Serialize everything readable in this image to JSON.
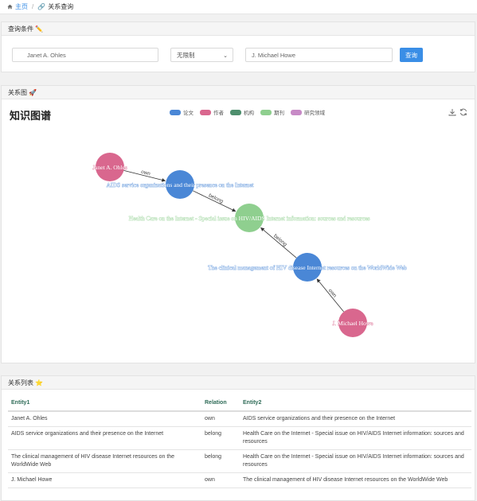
{
  "breadcrumb": {
    "home": "主页",
    "current": "关系查询"
  },
  "query": {
    "header": "查询条件",
    "header_emoji": "✏️",
    "entity1_value": "Janet A. Ohles",
    "relation_value": "无限制",
    "entity2_value": "J. Michael Howe",
    "search_label": "查询"
  },
  "graph": {
    "header": "关系图",
    "header_emoji": "🚀",
    "title": "知识图谱",
    "legend": [
      {
        "label": "论文",
        "color": "#4a87d6"
      },
      {
        "label": "作者",
        "color": "#d9678e"
      },
      {
        "label": "机构",
        "color": "#4e8f6e"
      },
      {
        "label": "期刊",
        "color": "#8fcf8f"
      },
      {
        "label": "研究领域",
        "color": "#c78ac6"
      }
    ],
    "nodes": [
      {
        "label": "Janet A. Ohles",
        "type": "作者",
        "color": "#d9678e",
        "label_color": "#ffffff",
        "label_stroke": "#d9678e"
      },
      {
        "label": "AIDS service organizations and their presence on the Internet",
        "type": "论文",
        "color": "#4a87d6",
        "label_color": "#ffffff",
        "label_stroke": "#4a87d6"
      },
      {
        "label": "Health Care on the Internet - Special issue on HIV/AIDS Internet information: sources and resources",
        "type": "期刊",
        "color": "#8fcf8f",
        "label_color": "#ffffff",
        "label_stroke": "#8fcf8f"
      },
      {
        "label": "The clinical management of HIV disease Internet resources on the WorldWide Web",
        "type": "论文",
        "color": "#4a87d6",
        "label_color": "#ffffff",
        "label_stroke": "#4a87d6"
      },
      {
        "label": "J. Michael Howe",
        "type": "作者",
        "color": "#d9678e",
        "label_color": "#ffffff",
        "label_stroke": "#d9678e"
      }
    ],
    "edges": [
      {
        "from": 0,
        "to": 1,
        "label": "own"
      },
      {
        "from": 1,
        "to": 2,
        "label": "belong"
      },
      {
        "from": 3,
        "to": 2,
        "label": "belong"
      },
      {
        "from": 4,
        "to": 3,
        "label": "own"
      }
    ]
  },
  "list": {
    "header": "关系列表",
    "header_emoji": "⭐",
    "columns": [
      "Entity1",
      "Relation",
      "Entity2"
    ],
    "rows": [
      [
        "Janet A. Ohles",
        "own",
        "AIDS service organizations and their presence on the Internet"
      ],
      [
        "AIDS service organizations and their presence on the Internet",
        "belong",
        "Health Care on the Internet - Special issue on HIV/AIDS Internet information: sources and resources"
      ],
      [
        "The clinical management of HIV disease Internet resources on the WorldWide Web",
        "belong",
        "Health Care on the Internet - Special issue on HIV/AIDS Internet information: sources and resources"
      ],
      [
        "J. Michael Howe",
        "own",
        "The clinical management of HIV disease Internet resources on the WorldWide Web"
      ]
    ]
  }
}
